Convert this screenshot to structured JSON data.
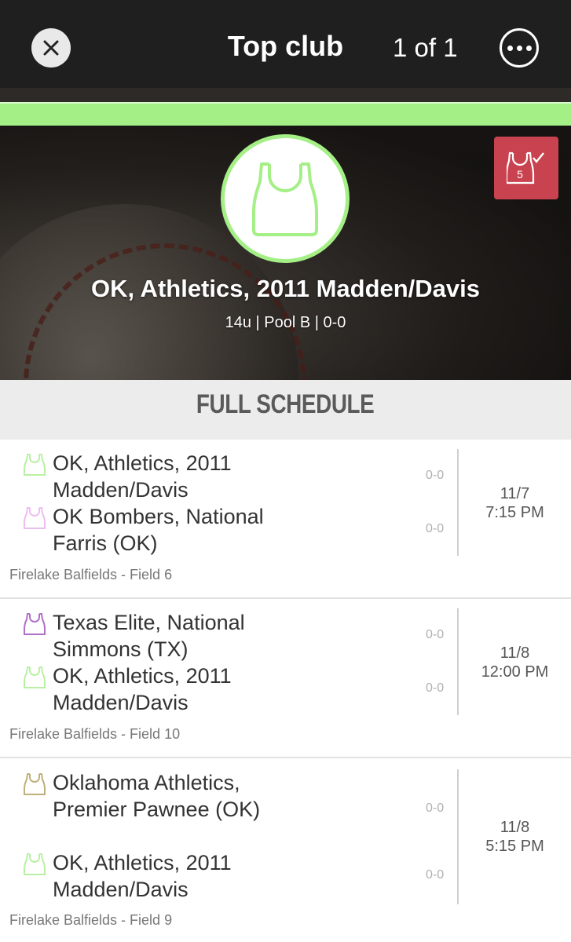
{
  "topbar": {
    "title": "Top club",
    "counter": "1 of 1",
    "close_icon": "close-icon",
    "more_icon": "more-icon"
  },
  "hero": {
    "team_name": "OK, Athletics, 2011 Madden/Davis",
    "meta": "14u | Pool B | 0-0",
    "badge_number": "5",
    "logo_color": "#a4ef86",
    "badge_color": "#c8434f"
  },
  "schedule": {
    "heading": "FULL SCHEDULE",
    "games": [
      {
        "team1": {
          "name": "OK, Athletics, 2011 Madden/Davis",
          "record": "0-0",
          "color": "#b9f0a3"
        },
        "team2": {
          "name": "OK Bombers, National Farris (OK)",
          "record": "0-0",
          "color": "#ecbdf0"
        },
        "date": "11/7",
        "time": "7:15 PM",
        "venue": "Firelake Balfields - Field 6"
      },
      {
        "team1": {
          "name": "Texas Elite, National Simmons (TX)",
          "record": "0-0",
          "color": "#b070c8"
        },
        "team2": {
          "name": "OK, Athletics, 2011 Madden/Davis",
          "record": "0-0",
          "color": "#b9f0a3"
        },
        "date": "11/8",
        "time": "12:00 PM",
        "venue": "Firelake Balfields - Field 10"
      },
      {
        "team1": {
          "name": "Oklahoma Athletics, Premier Pawnee (OK)",
          "record": "0-0",
          "color": "#bfb07a"
        },
        "team2": {
          "name": "OK, Athletics, 2011 Madden/Davis",
          "record": "0-0",
          "color": "#b9f0a3"
        },
        "date": "11/8",
        "time": "5:15 PM",
        "venue": "Firelake Balfields - Field 9"
      }
    ]
  }
}
